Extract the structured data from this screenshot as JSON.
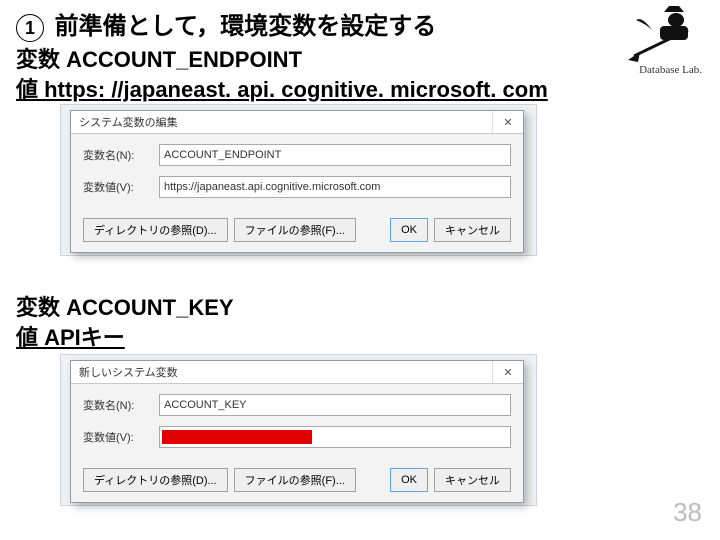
{
  "headline": {
    "number": "1",
    "text": "前準備として，環境変数を設定する"
  },
  "section1": {
    "var_label": "変数 ACCOUNT_ENDPOINT",
    "val_label": "値 https: //japaneast. api. cognitive. microsoft. com"
  },
  "section2": {
    "var_label": "変数 ACCOUNT_KEY",
    "val_label": "値 APIキー"
  },
  "dialog1": {
    "title": "システム変数の編集",
    "close": "✕",
    "name_label": "変数名(N):",
    "name_value": "ACCOUNT_ENDPOINT",
    "value_label": "変数値(V):",
    "value_value": "https://japaneast.api.cognitive.microsoft.com",
    "browse_dir": "ディレクトリの参照(D)...",
    "browse_file": "ファイルの参照(F)...",
    "ok": "OK",
    "cancel": "キャンセル"
  },
  "dialog2": {
    "title": "新しいシステム変数",
    "close": "✕",
    "name_label": "変数名(N):",
    "name_value": "ACCOUNT_KEY",
    "value_label": "変数値(V):",
    "value_value": "",
    "browse_dir": "ディレクトリの参照(D)...",
    "browse_file": "ファイルの参照(F)...",
    "ok": "OK",
    "cancel": "キャンセル"
  },
  "logo": {
    "script_name": "Database Lab."
  },
  "page_number": "38"
}
